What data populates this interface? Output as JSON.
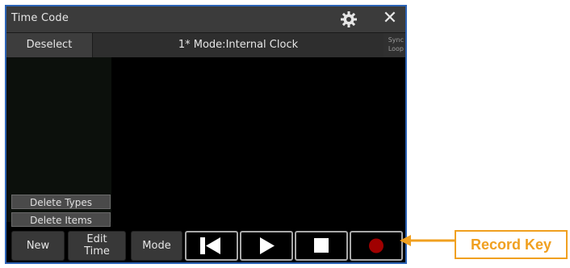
{
  "window": {
    "title": "Time Code",
    "settings_icon": "gear-icon",
    "close_label": "✕"
  },
  "toolbar": {
    "deselect_label": "Deselect",
    "mode_text": "1* Mode:Internal Clock",
    "sync_label": "Sync",
    "loop_label": "Loop"
  },
  "side_panel": {
    "delete_types_label": "Delete Types",
    "delete_items_label": "Delete Items"
  },
  "bottom_bar": {
    "new_label": "New",
    "edit_time_line1": "Edit",
    "edit_time_line2": "Time",
    "mode_label": "Mode",
    "transport_icons": [
      "skip-back-icon",
      "play-icon",
      "stop-icon",
      "record-icon"
    ]
  },
  "annotation": {
    "callout_label": "Record Key"
  },
  "colors": {
    "window_border": "#2c63b5",
    "record_red": "#a00000",
    "callout_orange": "#f0a020"
  }
}
